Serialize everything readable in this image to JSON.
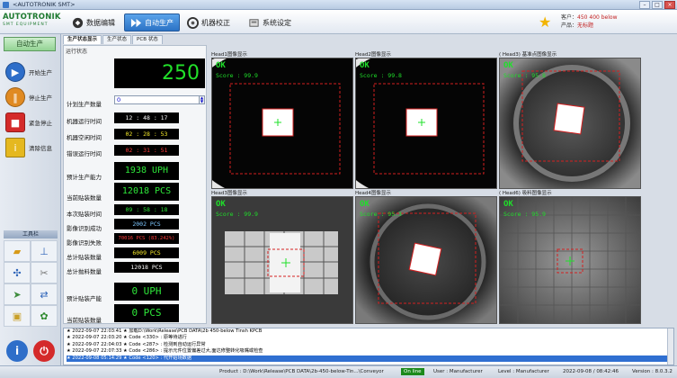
{
  "window": {
    "title": "<AUTOTRONIK SMT>"
  },
  "header": {
    "logo_text": "AUTOTRONIK",
    "logo_sub": "SMT EQUIPMENT",
    "tabs": [
      {
        "label": "数据编辑"
      },
      {
        "label": "自动生产"
      },
      {
        "label": "机器校正"
      },
      {
        "label": "系统设定"
      }
    ],
    "customer_label": "客户：",
    "customer_value": "450 400 below",
    "product_label": "产品：",
    "product_value": "无标题"
  },
  "sidebar": {
    "mode": "自动生产",
    "buttons": [
      {
        "label": "开始生产"
      },
      {
        "label": "停止生产"
      },
      {
        "label": "紧急停止"
      },
      {
        "label": "清除信息"
      }
    ],
    "tools_title": "工具栏"
  },
  "subtabs": [
    {
      "label": "生产状态显示"
    },
    {
      "label": "生产状态"
    },
    {
      "label": "PCB 状态"
    }
  ],
  "status": {
    "title": "运行状态",
    "count": "250",
    "plan_label": "计划生产数量",
    "plan_value": "0",
    "run_time_label": "机器运行时间",
    "run_time": "12 : 48 : 17",
    "idle_time_label": "机器空闲时间",
    "idle_time": "02 : 28 : 53",
    "error_time_label": "错误运行时间",
    "error_time": "02 : 31 : 51",
    "forecast_label": "预计生产能力",
    "forecast": "1938 UPH",
    "current_label": "当前贴装数量",
    "current": "12018 PCS",
    "cycle_label": "本次贴装时间",
    "cycle": "09 : 58 : 18",
    "vision_ok_label": "影像识别成功",
    "vision_ok": "2002 PCS",
    "vision_fail_label": "影像识别失败",
    "vision_fail": "70016 PCS (83.242%)",
    "total_place_label": "总计贴装数量",
    "total_place": "6009 PCS",
    "total_pick_label": "总计抛料数量",
    "total_pick": "12018 PCS",
    "forecast2_label": "预计贴装产能",
    "forecast2": "0 UPH",
    "current2_label": "当前贴装数量",
    "current2": "0 PCS"
  },
  "cameras": [
    {
      "title": "Head1图像显示",
      "result": "OK",
      "score": "Score : 99.9"
    },
    {
      "title": "Head2图像显示",
      "result": "OK",
      "score": "Score : 99.8"
    },
    {
      "title": "( Head3) 基准点图像显示",
      "result": "OK",
      "score": "Score : 95.8"
    },
    {
      "title": "Head3图像显示",
      "result": "OK",
      "score": "Score : 99.9"
    },
    {
      "title": "Head4图像显示",
      "result": "OK",
      "score": "Score : 95.3"
    },
    {
      "title": "( Head6) 吸料图像显示",
      "result": "OK",
      "score": "Score : 95.9"
    }
  ],
  "log": [
    "★ 2022-09-07 22:03:41 ★ 加载D:\\Work\\Release\\PCB DATA\\2b 450-below Tinsh KPCB",
    "★ 2022-09-07 22:03:20 ★ Code <330> : 原等待进行",
    "★ 2022-09-07 22:04:03 ★ Code <287> : 检测到自动运行异常",
    "★ 2022-09-07 22:07:33 ★ Code <286> : 提示元件位置偏差过大,面达修整转化吸嘴或检查",
    "★ 2022-09-08 05:14:29 ★ Code <120> : 代开始场数据"
  ],
  "statusbar": {
    "product": "Product : D:\\Work\\Release\\PCB DATA\\2b-450-below-Tin...\\Conveyor",
    "online": "On line",
    "user": "User : Manufacturer",
    "level": "Level : Manufacturer",
    "datetime": "2022-09-08 / 08:42:46",
    "version": "Version : 8.0.3.2"
  },
  "colors": {
    "accent": "#2b72c5",
    "lcd_green": "#22e02a",
    "ok_green": "#1fe02a",
    "roi_red": "#d42020"
  }
}
